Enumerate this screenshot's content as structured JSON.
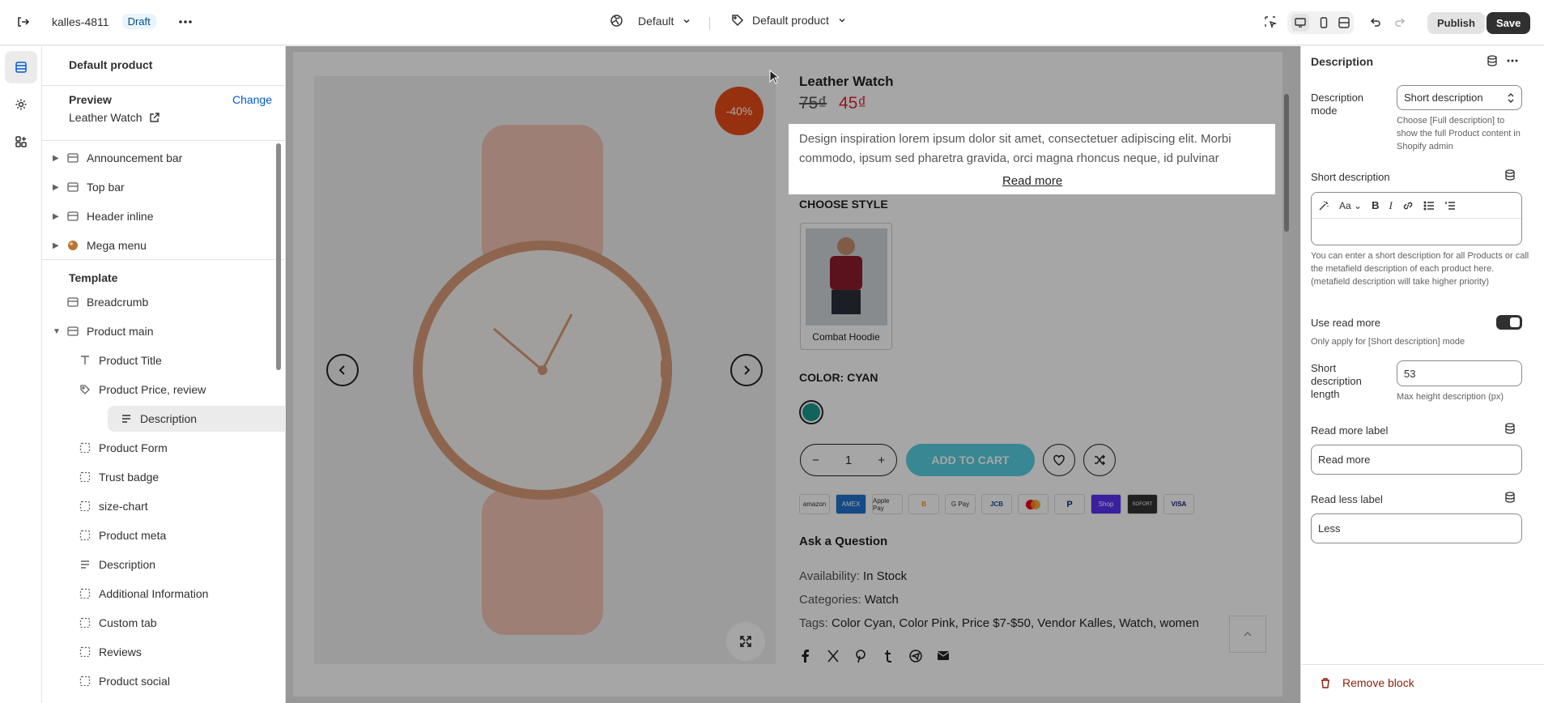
{
  "topbar": {
    "store_name": "kalles-4811",
    "status_badge": "Draft",
    "theme_label": "Default",
    "template_label": "Default product",
    "publish_label": "Publish",
    "save_label": "Save"
  },
  "sidebar": {
    "title": "Default product",
    "preview_label": "Preview",
    "change_label": "Change",
    "preview_product": "Leather Watch",
    "header_sections": [
      {
        "label": "Announcement bar",
        "icon": "section-icon"
      },
      {
        "label": "Top bar",
        "icon": "section-icon"
      },
      {
        "label": "Header inline",
        "icon": "section-icon"
      },
      {
        "label": "Mega menu",
        "icon": "app-icon"
      }
    ],
    "template_label": "Template",
    "template_items": [
      {
        "label": "Breadcrumb",
        "icon": "section-icon"
      },
      {
        "label": "Product main",
        "icon": "section-icon"
      }
    ],
    "blocks": [
      {
        "label": "Product Title",
        "icon": "text-icon"
      },
      {
        "label": "Product Price, review",
        "icon": "price-icon"
      },
      {
        "label": "Description",
        "icon": "lines-icon"
      },
      {
        "label": "Product Form",
        "icon": "block-icon"
      },
      {
        "label": "Trust badge",
        "icon": "block-icon"
      },
      {
        "label": "size-chart",
        "icon": "block-icon"
      },
      {
        "label": "Product meta",
        "icon": "block-icon"
      },
      {
        "label": "Description",
        "icon": "lines-icon"
      },
      {
        "label": "Additional Information",
        "icon": "block-icon"
      },
      {
        "label": "Custom tab",
        "icon": "block-icon"
      },
      {
        "label": "Reviews",
        "icon": "block-icon"
      },
      {
        "label": "Product social",
        "icon": "block-icon"
      }
    ]
  },
  "product": {
    "sale_badge": "-40%",
    "title": "Leather Watch",
    "price_old": "75₫",
    "price_new": "45₫",
    "description": "Design inspiration lorem ipsum dolor sit amet, consectetuer adipiscing elit. Morbi commodo, ipsum sed pharetra gravida, orci magna rhoncus neque, id pulvinar",
    "read_more": "Read more",
    "style_label": "CHOOSE STYLE",
    "variant_name": "Combat Hoodie",
    "color_label": "COLOR: CYAN",
    "swatch_color": "#1b9a8d",
    "quantity": "1",
    "add_to_cart": "ADD TO CART",
    "payment_methods": [
      "amazon",
      "AMEX",
      "Apple Pay",
      "B",
      "G Pay",
      "JCB",
      "mastercard",
      "P",
      "Shop",
      "SOFORT",
      "VISA"
    ],
    "ask_question": "Ask a Question",
    "availability_label": "Availability:",
    "availability_value": "In Stock",
    "categories_label": "Categories:",
    "categories_value": "Watch",
    "tags_label": "Tags:",
    "tags_value": "Color Cyan, Color Pink, Price $7-$50, Vendor Kalles, Watch, women"
  },
  "panel": {
    "title": "Description",
    "mode_label": "Description mode",
    "mode_value": "Short description",
    "mode_help": "Choose [Full description] to show the full Product content in Shopify admin",
    "short_desc_label": "Short description",
    "short_desc_help": "You can enter a short description for all Products or call the metafield description of each product here. (metafield description will take higher priority)",
    "use_read_more_label": "Use read more",
    "use_read_more_on": true,
    "use_read_more_help": "Only apply for [Short description] mode",
    "length_label": "Short description length",
    "length_value": "53",
    "length_help": "Max height description (px)",
    "read_more_label": "Read more label",
    "read_more_value": "Read more",
    "read_less_label": "Read less label",
    "read_less_value": "Less",
    "remove_block": "Remove block"
  }
}
